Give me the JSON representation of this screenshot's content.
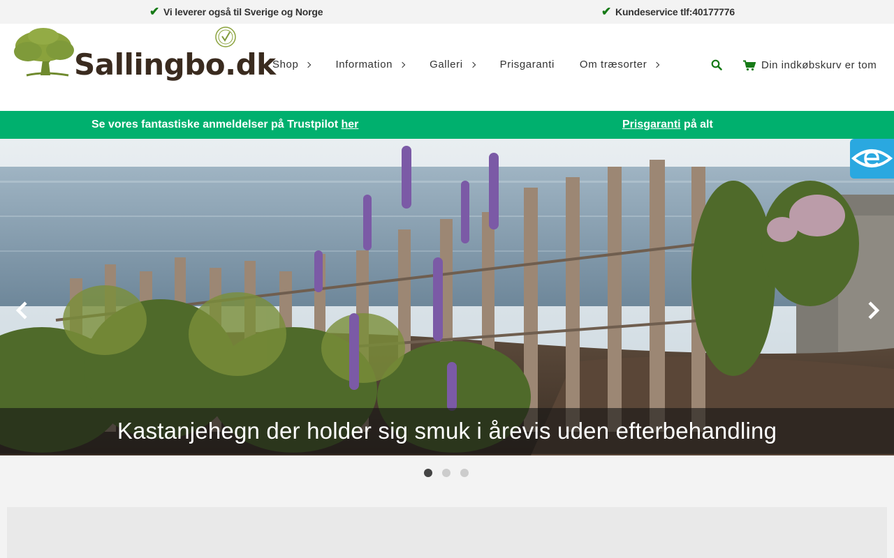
{
  "topbar": {
    "usp_left": "Vi leverer også til Sverige og Norge",
    "usp_right": "Kundeservice tlf:40177776",
    "check_icon": "check-icon"
  },
  "header": {
    "logo_text": "Sallingbo.dk",
    "nav": [
      {
        "label": "Shop",
        "has_submenu": true
      },
      {
        "label": "Information",
        "has_submenu": true
      },
      {
        "label": "Galleri",
        "has_submenu": true
      },
      {
        "label": "Prisgaranti",
        "has_submenu": false
      },
      {
        "label": "Om træsorter",
        "has_submenu": true
      }
    ],
    "search_icon": "search-icon",
    "cart_label": "Din indkøbskurv er tom",
    "cart_icon": "cart-icon"
  },
  "promo": {
    "left_text": "Se vores fantastiske anmeldelser på Trustpilot ",
    "left_link": "her",
    "right_link": "Prisgaranti",
    "right_text": " på alt"
  },
  "slider": {
    "caption": "Kastanjehegn der holder sig smuk i årevis uden efterbehandling",
    "slide_count": 3,
    "active_slide": 1
  },
  "colors": {
    "promo_green": "#00b06e",
    "check_green": "#167a16",
    "eye_badge_blue": "#2aa8e0",
    "logo_green": "#7f9a3a",
    "logo_brown": "#3a2b1f"
  }
}
